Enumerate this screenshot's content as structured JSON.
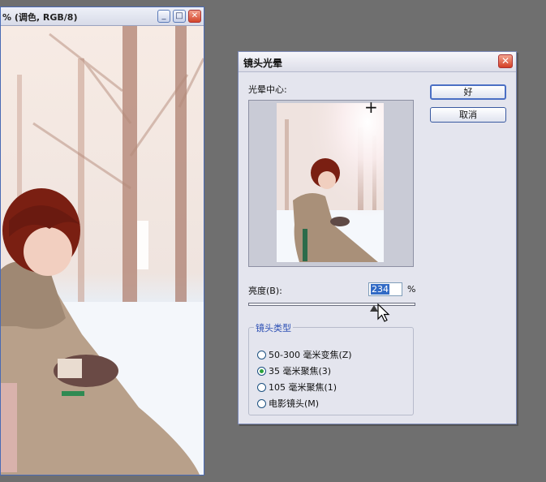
{
  "document_window": {
    "title": "% (调色, RGB/8)",
    "minimize_glyph": "_",
    "maximize_glyph": "□",
    "close_glyph": "✕"
  },
  "dialog": {
    "title": "镜头光晕",
    "close_glyph": "✕",
    "flare_center_label": "光晕中心:",
    "crosshair_glyph": "+",
    "ok_label": "好",
    "cancel_label": "取消",
    "brightness_label": "亮度(B):",
    "brightness_value": "234",
    "brightness_unit": "%",
    "brightness_slider_fraction": 0.78,
    "lens_type_title": "镜头类型",
    "lens_types": [
      {
        "label": "50-300 毫米变焦(Z)",
        "checked": false
      },
      {
        "label": "35 毫米聚焦(3)",
        "checked": true
      },
      {
        "label": "105 毫米聚焦(1)",
        "checked": false
      },
      {
        "label": "电影镜头(M)",
        "checked": false
      }
    ]
  },
  "colors": {
    "desktop": "#6f6f6f",
    "dialog_bg": "#e4e5ee",
    "group_title": "#2c4fb4",
    "radio_dot": "#2aa13b",
    "close_button": "#d43f25"
  }
}
